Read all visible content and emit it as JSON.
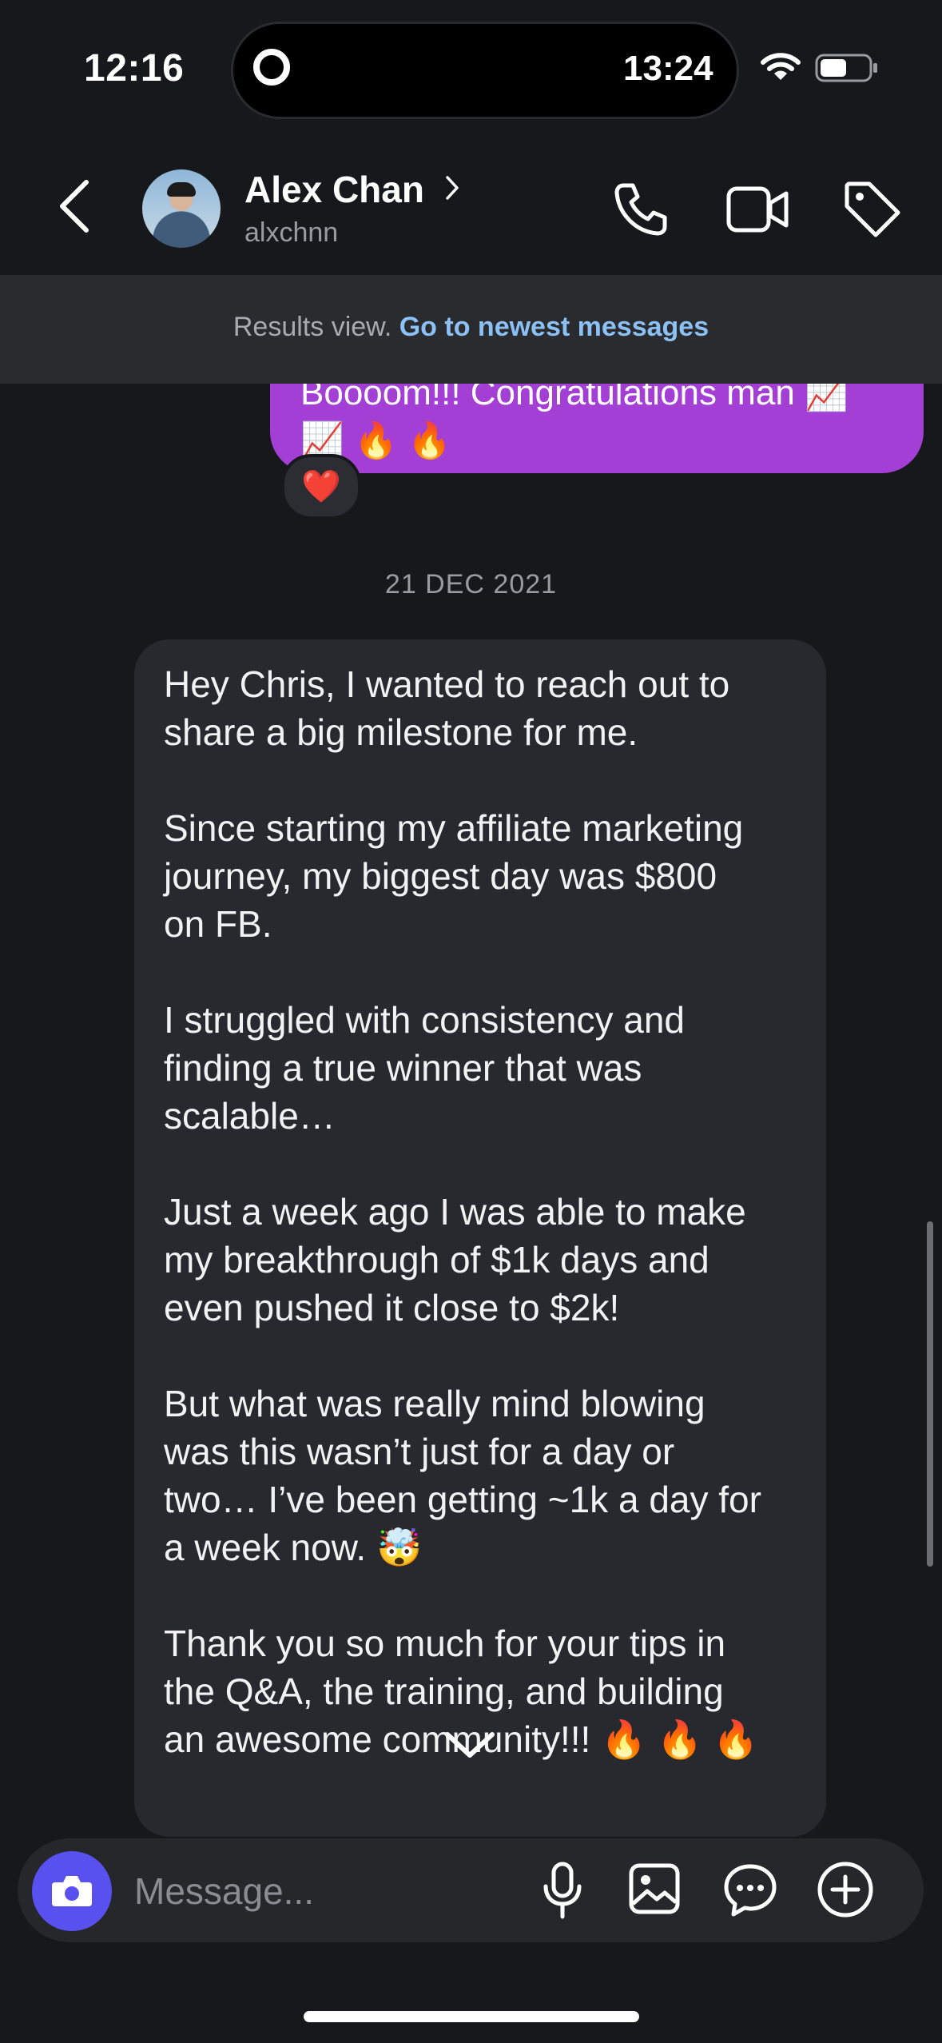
{
  "status_bar": {
    "time": "12:16",
    "island_time": "13:24"
  },
  "header": {
    "name": "Alex Chan",
    "handle": "alxchnn"
  },
  "banner": {
    "text": "Results view.",
    "link": "Go to newest messages"
  },
  "sent_message": {
    "text": "Boooom!!! Congratulations man 📈\n📈 🔥 🔥",
    "reaction": "❤️"
  },
  "date_separator": "21 DEC 2021",
  "received_message": {
    "text": "Hey Chris, I wanted to reach out to\nshare a big milestone for me.\n\nSince starting my affiliate marketing\njourney, my biggest day was $800\non FB.\n\nI struggled with consistency and\nfinding a true winner that was\nscalable…\n\nJust a week ago I was able to make\nmy breakthrough of $1k days and\neven pushed it close to $2k!\n\nBut what was really mind blowing\nwas this wasn’t just for a day or\ntwo… I’ve been getting ~1k a day for\na week now. 🤯\n\nThank you so much for your tips in\nthe Q&A, the training, and building\nan awesome community!!! 🔥 🔥 🔥"
  },
  "composer": {
    "placeholder": "Message..."
  },
  "colors": {
    "sent_bubble": "#a43fd6",
    "received_bubble": "#28292e",
    "camera_button": "#5851f0",
    "link": "#8cc1f5"
  }
}
